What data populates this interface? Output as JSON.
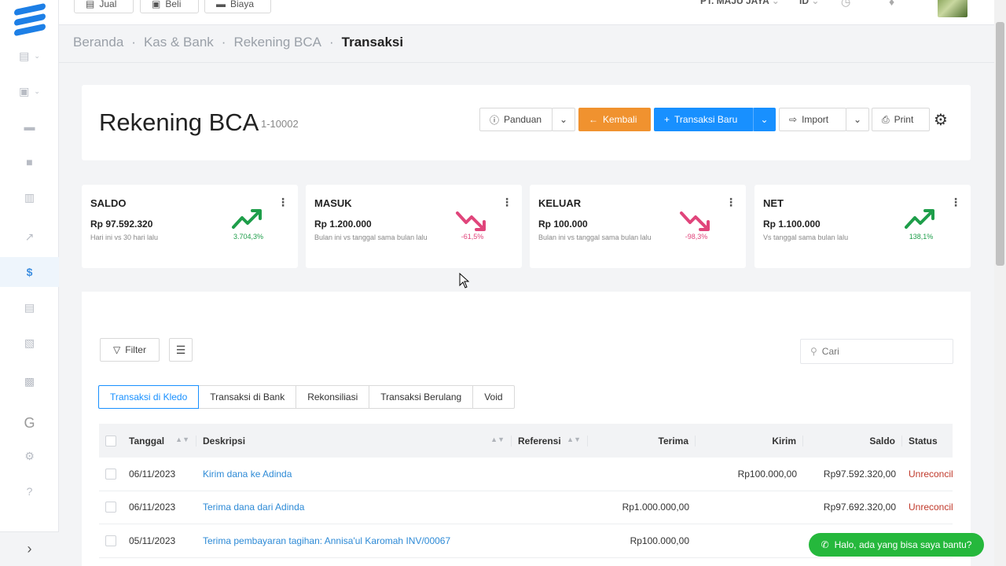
{
  "topbar": {
    "buttons": [
      {
        "label": "Jual",
        "icon": "shop-icon"
      },
      {
        "label": "Beli",
        "icon": "bag-icon"
      },
      {
        "label": "Biaya",
        "icon": "card-icon"
      }
    ],
    "company": "PT. MAJU JAYA",
    "language": "ID"
  },
  "breadcrumb": [
    "Beranda",
    "Kas & Bank",
    "Rekening BCA",
    "Transaksi"
  ],
  "header": {
    "title": "Rekening BCA",
    "code": "1-10002",
    "guide_label": "Panduan",
    "back_label": "Kembali",
    "new_label": "Transaksi Baru",
    "import_label": "Import",
    "print_label": "Print"
  },
  "stats": [
    {
      "label": "SALDO",
      "amount": "Rp 97.592.320",
      "desc": "Hari ini vs 30 hari lalu",
      "pct": "3.704,3%",
      "trend": "up",
      "color": "#1e9e4a"
    },
    {
      "label": "MASUK",
      "amount": "Rp 1.200.000",
      "desc": "Bulan ini vs tanggal sama bulan lalu",
      "pct": "-61,5%",
      "trend": "down",
      "color": "#e0457b"
    },
    {
      "label": "KELUAR",
      "amount": "Rp 100.000",
      "desc": "Bulan ini vs tanggal sama bulan lalu",
      "pct": "-98,3%",
      "trend": "down",
      "color": "#e0457b"
    },
    {
      "label": "NET",
      "amount": "Rp 1.100.000",
      "desc": "Vs tanggal sama bulan lalu",
      "pct": "138,1%",
      "trend": "up",
      "color": "#1e9e4a"
    }
  ],
  "toolbar": {
    "filter_label": "Filter",
    "search_placeholder": "Cari"
  },
  "tabs": [
    "Transaksi di Kledo",
    "Transaksi di Bank",
    "Rekonsiliasi",
    "Transaksi Berulang",
    "Void"
  ],
  "table": {
    "columns": [
      "Tanggal",
      "Deskripsi",
      "Referensi",
      "Terima",
      "Kirim",
      "Saldo",
      "Status"
    ],
    "rows": [
      {
        "date": "06/11/2023",
        "desc": "Kirim dana ke Adinda",
        "ref": "",
        "in": "",
        "out": "Rp100.000,00",
        "balance": "Rp97.592.320,00",
        "status": "Unreconciled"
      },
      {
        "date": "06/11/2023",
        "desc": "Terima dana dari Adinda",
        "ref": "",
        "in": "Rp1.000.000,00",
        "out": "",
        "balance": "Rp97.692.320,00",
        "status": "Unreconciled"
      },
      {
        "date": "05/11/2023",
        "desc": "Terima pembayaran tagihan: Annisa'ul Karomah INV/00067",
        "ref": "",
        "in": "Rp100.000,00",
        "out": "",
        "balance": "",
        "status": ""
      }
    ]
  },
  "chat": {
    "label": "Halo, ada yang bisa saya bantu?"
  },
  "sidebar": {
    "expand_icon": "chevron-right-icon"
  }
}
